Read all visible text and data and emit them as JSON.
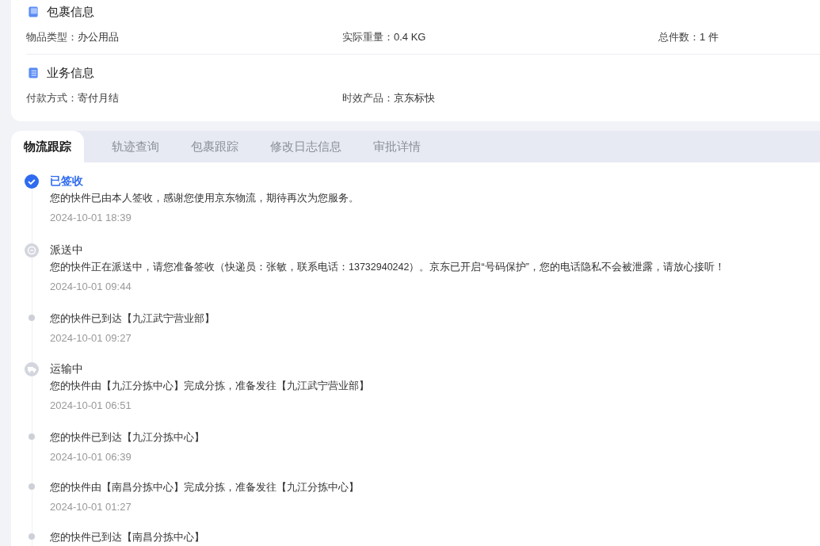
{
  "sections": [
    {
      "title": "包裹信息",
      "fields": [
        {
          "label": "物品类型：",
          "value": "办公用品"
        },
        {
          "label": "实际重量：",
          "value": "0.4 KG"
        },
        {
          "label": "总件数：",
          "value": "1 件"
        }
      ]
    },
    {
      "title": "业务信息",
      "fields": [
        {
          "label": "付款方式：",
          "value": "寄付月结"
        },
        {
          "label": "时效产品：",
          "value": "京东标快"
        }
      ]
    }
  ],
  "tabs": [
    {
      "label": "物流跟踪",
      "selected": true
    },
    {
      "label": "轨迹查询",
      "selected": false
    },
    {
      "label": "包裹跟踪",
      "selected": false
    },
    {
      "label": "修改日志信息",
      "selected": false
    },
    {
      "label": "审批详情",
      "selected": false
    }
  ],
  "timeline": [
    {
      "kind": "signed",
      "current": true,
      "title": "已签收",
      "text": "您的快件已由本人签收，感谢您使用京东物流，期待再次为您服务。",
      "time": "2024-10-01 18:39"
    },
    {
      "kind": "delivering",
      "current": false,
      "title": "派送中",
      "text": "您的快件正在派送中，请您准备签收（快递员：张敏，联系电话：13732940242）。京东已开启“号码保护”，您的电话隐私不会被泄露，请放心接听！",
      "time": "2024-10-01 09:44"
    },
    {
      "kind": "dot",
      "text": "您的快件已到达【九江武宁营业部】",
      "time": "2024-10-01 09:27"
    },
    {
      "kind": "transit",
      "current": false,
      "title": "运输中",
      "text": "您的快件由【九江分拣中心】完成分拣，准备发往【九江武宁营业部】",
      "time": "2024-10-01 06:51"
    },
    {
      "kind": "dot",
      "text": "您的快件已到达【九江分拣中心】",
      "time": "2024-10-01 06:39"
    },
    {
      "kind": "dot",
      "text": "您的快件由【南昌分拣中心】完成分拣，准备发往【九江分拣中心】",
      "time": "2024-10-01 01:27"
    },
    {
      "kind": "dot",
      "text": "您的快件已到达【南昌分拣中心】"
    }
  ]
}
